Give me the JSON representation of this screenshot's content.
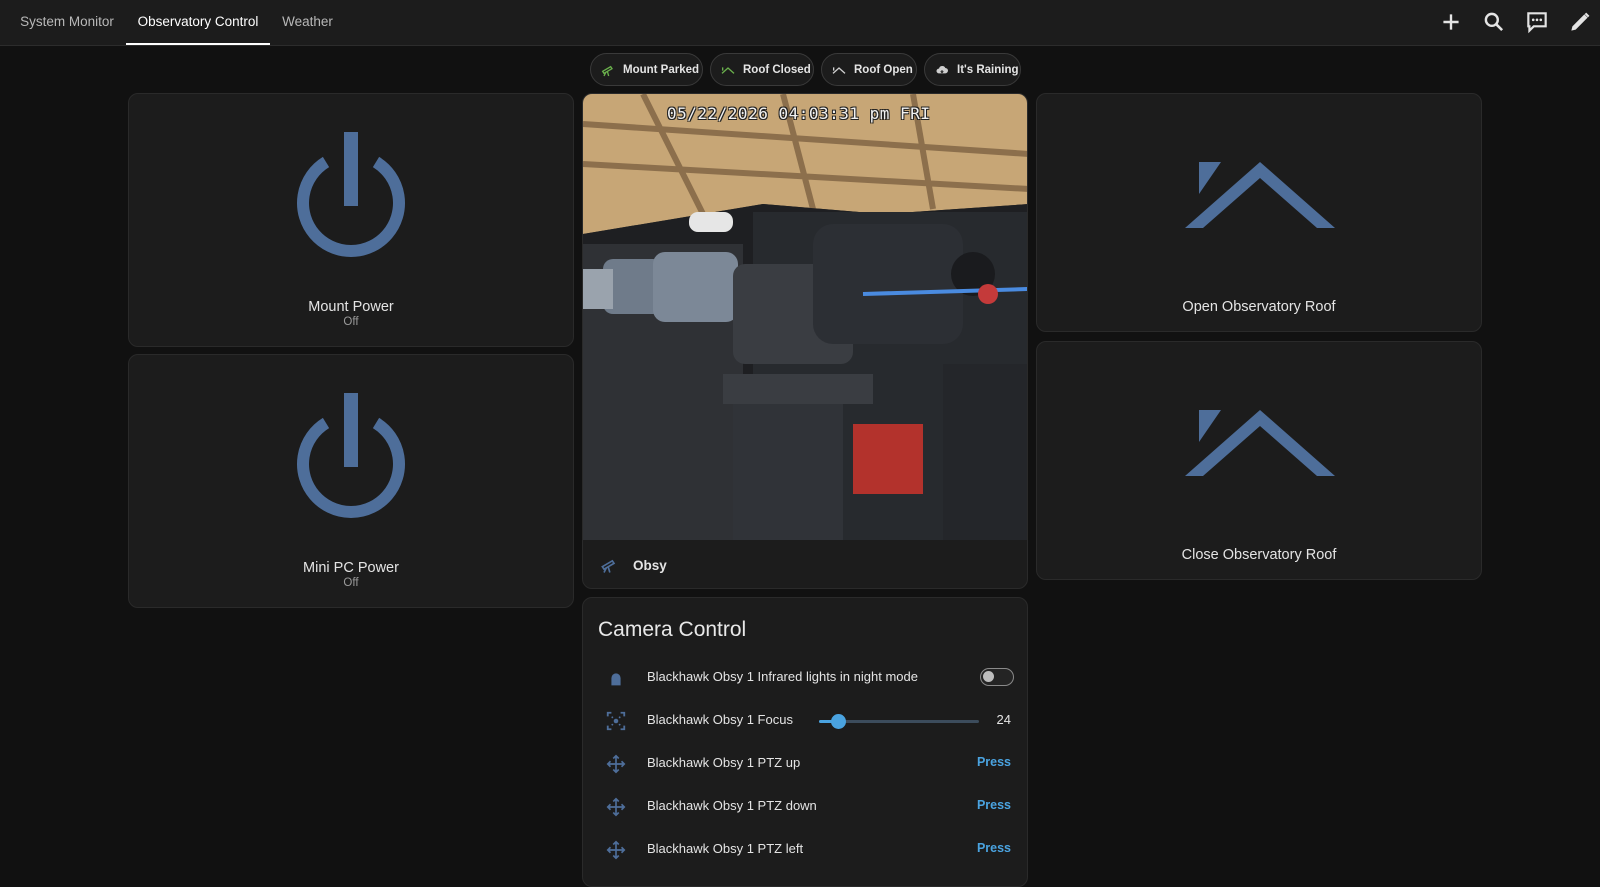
{
  "topbar": {
    "tabs": [
      {
        "label": "System Monitor",
        "active": false
      },
      {
        "label": "Observatory Control",
        "active": true
      },
      {
        "label": "Weather",
        "active": false
      }
    ],
    "actions": [
      "plus-icon",
      "search-icon",
      "chat-icon",
      "pencil-icon"
    ]
  },
  "chips": [
    {
      "label": "Mount Parked",
      "icon": "telescope-icon",
      "color": "#6ab04c"
    },
    {
      "label": "Roof Closed",
      "icon": "roof-icon",
      "color": "#6ab04c"
    },
    {
      "label": "Roof Open",
      "icon": "roof-icon",
      "color": "#cfcfcf"
    },
    {
      "label": "It's Raining",
      "icon": "cloud-icon",
      "color": "#cfcfcf"
    }
  ],
  "tiles": {
    "mount_power": {
      "name": "Mount Power",
      "state": "Off",
      "icon": "power-icon"
    },
    "mini_pc_power": {
      "name": "Mini PC Power",
      "state": "Off",
      "icon": "power-icon"
    },
    "open_roof": {
      "name": "Open Observatory Roof",
      "icon": "roof-icon"
    },
    "close_roof": {
      "name": "Close Observatory Roof",
      "icon": "roof-icon"
    }
  },
  "camera": {
    "timestamp": "05/22/2026 04:03:31 pm FRI",
    "name": "Obsy",
    "icon": "telescope-icon"
  },
  "camera_control": {
    "title": "Camera Control",
    "infrared": {
      "label": "Blackhawk Obsy 1 Infrared lights in night mode",
      "on": false,
      "icon": "bulb-icon"
    },
    "focus": {
      "label": "Blackhawk Obsy 1 Focus",
      "value": "24",
      "fraction": 0.12,
      "icon": "focus-icon"
    },
    "ptz_up": {
      "label": "Blackhawk Obsy 1 PTZ up",
      "action": "Press",
      "icon": "move-icon"
    },
    "ptz_down": {
      "label": "Blackhawk Obsy 1 PTZ down",
      "action": "Press",
      "icon": "move-icon"
    },
    "ptz_left": {
      "label": "Blackhawk Obsy 1 PTZ left",
      "action": "Press",
      "icon": "move-icon"
    }
  },
  "colors": {
    "accent": "#4aa3e0",
    "icon_blue": "#4e6e9a",
    "card": "#1c1c1c",
    "background": "#111111"
  }
}
